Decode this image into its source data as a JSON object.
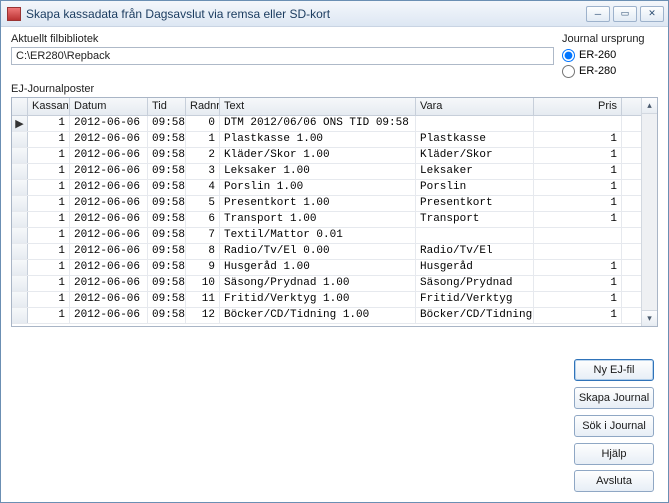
{
  "window": {
    "title": "Skapa kassadata från Dagsavslut via remsa eller SD-kort"
  },
  "pathblock": {
    "label": "Aktuellt filbibliotek",
    "value": "C:\\ER280\\Repback"
  },
  "radio": {
    "label": "Journal ursprung",
    "options": [
      {
        "label": "ER-260",
        "checked": true
      },
      {
        "label": "ER-280",
        "checked": false
      }
    ]
  },
  "grid": {
    "title": "EJ-Journalposter",
    "columns": {
      "kassanr": "Kassanr",
      "datum": "Datum",
      "tid": "Tid",
      "radnr": "Radnr",
      "text": "Text",
      "vara": "Vara",
      "pris": "Pris"
    },
    "rows": [
      {
        "kassanr": "1",
        "datum": "2012-06-06",
        "tid": "09:58",
        "radnr": "0",
        "text": "DTM 2012/06/06 ONS    TID 09:58",
        "vara": "",
        "pris": ""
      },
      {
        "kassanr": "1",
        "datum": "2012-06-06",
        "tid": "09:58",
        "radnr": "1",
        "text": "Plastkasse            1.00",
        "vara": "Plastkasse",
        "pris": "1"
      },
      {
        "kassanr": "1",
        "datum": "2012-06-06",
        "tid": "09:58",
        "radnr": "2",
        "text": "Kläder/Skor           1.00",
        "vara": "Kläder/Skor",
        "pris": "1"
      },
      {
        "kassanr": "1",
        "datum": "2012-06-06",
        "tid": "09:58",
        "radnr": "3",
        "text": "Leksaker              1.00",
        "vara": "Leksaker",
        "pris": "1"
      },
      {
        "kassanr": "1",
        "datum": "2012-06-06",
        "tid": "09:58",
        "radnr": "4",
        "text": "Porslin               1.00",
        "vara": "Porslin",
        "pris": "1"
      },
      {
        "kassanr": "1",
        "datum": "2012-06-06",
        "tid": "09:58",
        "radnr": "5",
        "text": "Presentkort           1.00",
        "vara": "Presentkort",
        "pris": "1"
      },
      {
        "kassanr": "1",
        "datum": "2012-06-06",
        "tid": "09:58",
        "radnr": "6",
        "text": "Transport             1.00",
        "vara": "Transport",
        "pris": "1"
      },
      {
        "kassanr": "1",
        "datum": "2012-06-06",
        "tid": "09:58",
        "radnr": "7",
        "text": "Textil/Mattor         0.01",
        "vara": "",
        "pris": ""
      },
      {
        "kassanr": "1",
        "datum": "2012-06-06",
        "tid": "09:58",
        "radnr": "8",
        "text": "Radio/Tv/El           0.00",
        "vara": "Radio/Tv/El",
        "pris": ""
      },
      {
        "kassanr": "1",
        "datum": "2012-06-06",
        "tid": "09:58",
        "radnr": "9",
        "text": "Husgeråd              1.00",
        "vara": "Husgeråd",
        "pris": "1"
      },
      {
        "kassanr": "1",
        "datum": "2012-06-06",
        "tid": "09:58",
        "radnr": "10",
        "text": "Säsong/Prydnad        1.00",
        "vara": "Säsong/Prydnad",
        "pris": "1"
      },
      {
        "kassanr": "1",
        "datum": "2012-06-06",
        "tid": "09:58",
        "radnr": "11",
        "text": "Fritid/Verktyg        1.00",
        "vara": "Fritid/Verktyg",
        "pris": "1"
      },
      {
        "kassanr": "1",
        "datum": "2012-06-06",
        "tid": "09:58",
        "radnr": "12",
        "text": "Böcker/CD/Tidning     1.00",
        "vara": "Böcker/CD/Tidning",
        "pris": "1"
      }
    ]
  },
  "buttons": {
    "newfile": "Ny EJ-fil",
    "createjournal": "Skapa Journal",
    "searchjournal": "Sök i Journal",
    "help": "Hjälp",
    "close": "Avsluta"
  }
}
